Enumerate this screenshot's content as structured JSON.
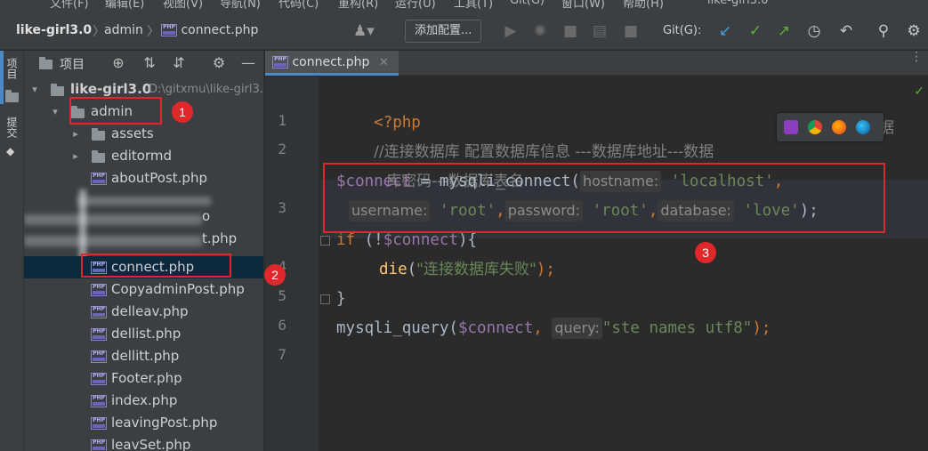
{
  "menu": {
    "items": [
      "文件(F)",
      "编辑(E)",
      "视图(V)",
      "导航(N)",
      "代码(C)",
      "重构(R)",
      "运行(U)",
      "工具(T)",
      "Git(G)",
      "窗口(W)",
      "帮助(H)"
    ],
    "window_title": "like-girl3.0"
  },
  "navbar": {
    "breadcrumb": [
      "like-girl3.0",
      "admin",
      "connect.php"
    ],
    "add_config_label": "添加配置...",
    "git_label": "Git(G):"
  },
  "left_strip": {
    "project_tab": "项目",
    "commit_tab": "提交"
  },
  "project": {
    "title": "项目",
    "root_name": "like-girl3.0",
    "root_path": "D:\\gitxmu\\like-girl3.0",
    "admin_folder": "admin",
    "items": [
      {
        "label": "assets",
        "type": "folder"
      },
      {
        "label": "editormd",
        "type": "folder"
      },
      {
        "label": "aboutPost.php",
        "type": "php"
      },
      {
        "label": "connect.php",
        "type": "php",
        "selected": true
      },
      {
        "label": "CopyadminPost.php",
        "type": "php"
      },
      {
        "label": "delleav.php",
        "type": "php"
      },
      {
        "label": "dellist.php",
        "type": "php"
      },
      {
        "label": "dellitt.php",
        "type": "php"
      },
      {
        "label": "Footer.php",
        "type": "php"
      },
      {
        "label": "index.php",
        "type": "php"
      },
      {
        "label": "leavingPost.php",
        "type": "php"
      },
      {
        "label": "leavSet.php",
        "type": "php"
      }
    ],
    "blurred_fragments": [
      "o",
      "t.php"
    ]
  },
  "editor": {
    "tab_label": "connect.php",
    "line_numbers": [
      "1",
      "2",
      "3",
      "4",
      "5",
      "6",
      "7"
    ],
    "code": {
      "l1": "<?php",
      "l2a": "//连接数据库 配置数据库信息 ---数据库地址---数据",
      "l2b": "据",
      "l2c": "库密码---数据库表名",
      "l3_var": "$connect",
      "l3_eq": " = mysqli_connect(",
      "l3_h1": "hostname:",
      "l3_s1": "'localhost'",
      "l3_comma": ",",
      "l3_h2": "username:",
      "l3_s2": "'root'",
      "l3_h3": "password:",
      "l3_s3": "'root'",
      "l3_h4": "database:",
      "l3_s4": "'love'",
      "l3_end": ");",
      "l4_kw": "if",
      "l4_a": " (!",
      "l4_var": "$connect",
      "l4_b": "){",
      "l5_fn": "die",
      "l5_str": "\"连接数据库失败\"",
      "l5_end": ");",
      "l6": "}",
      "l7_fn": "mysqli_query(",
      "l7_var": "$connect",
      "l7_comma": ", ",
      "l7_hint": "query:",
      "l7_str": "\"ste names utf8\"",
      "l7_end": ");"
    }
  },
  "annotations": [
    "1",
    "2",
    "3"
  ],
  "colors": {
    "accent": "#4a88c7",
    "annotation_red": "#e0282a",
    "php_purple": "#8a84c8"
  },
  "icons": {
    "toolbar": [
      "user-icon",
      "run-icon",
      "debug-icon",
      "coverage-icon",
      "profile-icon",
      "stop-icon",
      "git-update-icon",
      "git-commit-icon",
      "git-push-icon",
      "history-icon",
      "rollback-icon",
      "search-icon",
      "settings-icon"
    ],
    "browsers": [
      "phpstorm-icon",
      "chrome-icon",
      "firefox-icon",
      "edge-icon"
    ]
  }
}
